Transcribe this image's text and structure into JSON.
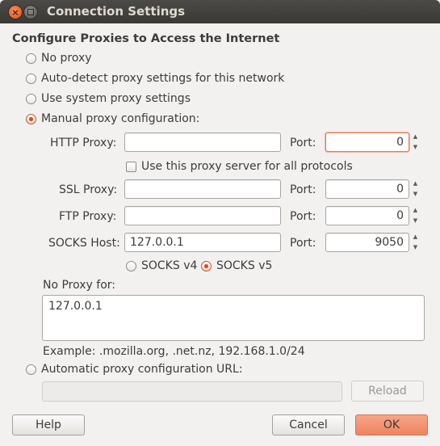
{
  "window": {
    "title": "Connection Settings"
  },
  "heading": "Configure Proxies to Access the Internet",
  "options": {
    "no_proxy": "No proxy",
    "auto_detect": "Auto-detect proxy settings for this network",
    "system": "Use system proxy settings",
    "manual": "Manual proxy configuration:",
    "auto_url": "Automatic proxy configuration URL:",
    "selected": "manual"
  },
  "manual": {
    "http_label": "HTTP Proxy:",
    "http_value": "",
    "http_port_label": "Port:",
    "http_port": "0",
    "use_all_label": "Use this proxy server for all protocols",
    "use_all_checked": false,
    "ssl_label": "SSL Proxy:",
    "ssl_value": "",
    "ssl_port_label": "Port:",
    "ssl_port": "0",
    "ftp_label": "FTP Proxy:",
    "ftp_value": "",
    "ftp_port_label": "Port:",
    "ftp_port": "0",
    "socks_label": "SOCKS Host:",
    "socks_value": "127.0.0.1",
    "socks_port_label": "Port:",
    "socks_port": "9050",
    "socks_v4": "SOCKS v4",
    "socks_v5": "SOCKS v5",
    "socks_version_selected": "v5"
  },
  "no_proxy": {
    "label": "No Proxy for:",
    "value": "127.0.0.1",
    "example": "Example: .mozilla.org, .net.nz, 192.168.1.0/24"
  },
  "auto_config": {
    "url_value": "",
    "reload_label": "Reload"
  },
  "buttons": {
    "help": "Help",
    "cancel": "Cancel",
    "ok": "OK"
  },
  "colors": {
    "accent": "#dd4814",
    "ok_button": "#ee8461",
    "titlebar": "#3c3b37"
  }
}
